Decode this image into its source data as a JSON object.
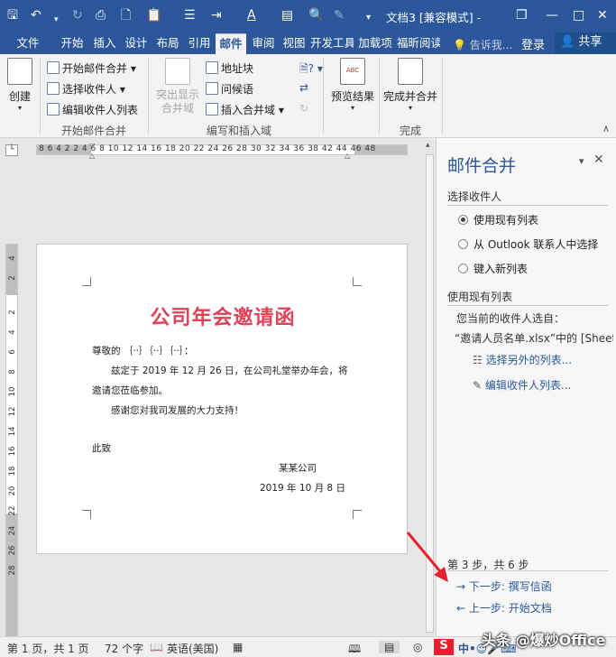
{
  "titlebar": {
    "title": "文档3 [兼容模式] -",
    "window_controls": [
      "restore-icon",
      "minimize-icon",
      "maximize-icon"
    ]
  },
  "tabs": [
    "文件",
    "开始",
    "插入",
    "设计",
    "布局",
    "引用",
    "邮件",
    "审阅",
    "视图",
    "开发工具",
    "加载项",
    "福昕阅读"
  ],
  "active_tab": "邮件",
  "tell_me": "告诉我...",
  "login": "登录",
  "share": "共享",
  "ribbon": {
    "create": "创建",
    "start_mail_merge": "开始邮件合并",
    "select_recipients": "选择收件人",
    "edit_recipient_list": "编辑收件人列表",
    "group_start": "开始邮件合并",
    "highlight_fields": "突出显示合并域",
    "address_block": "地址块",
    "greeting_line": "问候语",
    "insert_merge_field": "插入合并域",
    "group_write": "编写和插入域",
    "preview_results": "预览结果",
    "finish_merge": "完成并合并",
    "group_finish": "完成"
  },
  "ruler": {
    "h_numbers": "8  6  4  2      2  4  6  8  10 12 14 16 18 20 22 24 26 28 30 32 34 36 38     42 44 46 48",
    "v_numbers": [
      "4",
      "2",
      "",
      "2",
      "4",
      "6",
      "8",
      "10",
      "12",
      "14",
      "16",
      "18",
      "20",
      "22",
      "24",
      "26",
      "28"
    ]
  },
  "document": {
    "heading": "公司年会邀请函",
    "salutation": "尊敬的 ｛··｝｛··｝｛··｝：",
    "body1": "兹定于 2019 年 12 月 26 日，在公司礼堂举办年会，将",
    "body2": "邀请您莅临参加。",
    "body3": "感谢您对我司发展的大力支持！",
    "closing": "此致",
    "company": "某某公司",
    "date": "2019 年 10 月 8 日"
  },
  "panel": {
    "title": "邮件合并",
    "select_recipients": "选择收件人",
    "options": [
      "使用现有列表",
      "从 Outlook 联系人中选择",
      "键入新列表"
    ],
    "selected_option": 0,
    "use_existing": "使用现有列表",
    "current_source_label": "您当前的收件人选自：",
    "current_source": "“邀请人员名单.xlsx”中的 [Sheet",
    "select_other_list": "选择另外的列表...",
    "edit_recipient_list": "编辑收件人列表...",
    "step": "第 3 步，共 6 步",
    "next_step": "下一步: 撰写信函",
    "prev_step": "上一步: 开始文档"
  },
  "status": {
    "page": "第 1 页，共 1 页",
    "words": "72 个字",
    "language": "英语(美国)"
  },
  "watermark": "头条 @爆炒Office",
  "colors": {
    "brand": "#2b579a",
    "heading_red": "#e04356",
    "arrow_red": "#e8202b"
  }
}
